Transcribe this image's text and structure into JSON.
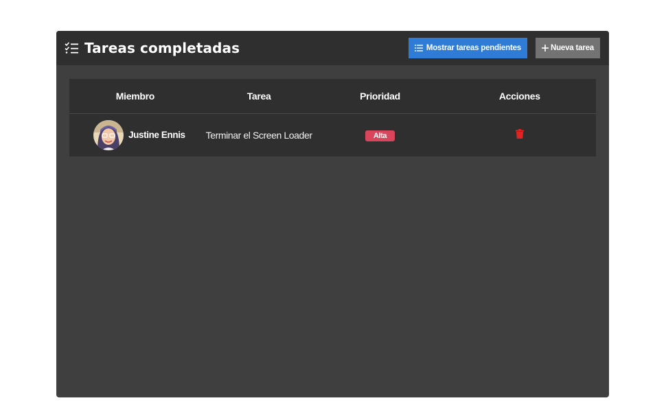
{
  "header": {
    "title": "Tareas completadas",
    "title_icon": "task-list-check-icon",
    "show_pending_label": "Mostrar tareas pendientes",
    "show_pending_icon": "list-icon",
    "new_task_label": "Nueva tarea",
    "new_task_icon": "plus-icon"
  },
  "table": {
    "columns": [
      "Miembro",
      "Tarea",
      "Prioridad",
      "Acciones"
    ],
    "rows": [
      {
        "member": "Justine Ennis",
        "task": "Terminar el Screen Loader",
        "priority": "Alta",
        "action_icon": "trash-icon"
      }
    ]
  },
  "colors": {
    "panel_bg": "#3f3f3f",
    "header_bg": "#2f2f2f",
    "primary_button": "#2f7cd6",
    "secondary_button": "#737373",
    "priority_high": "#d9455b",
    "delete_icon": "#e02424"
  }
}
